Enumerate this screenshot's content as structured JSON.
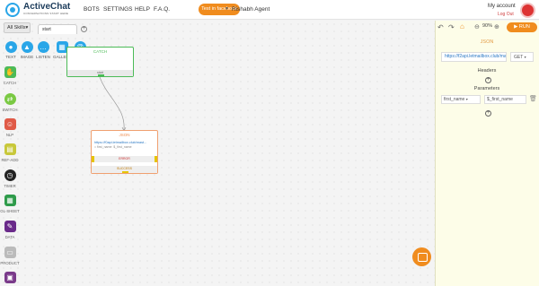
{
  "header": {
    "brand": "ActiveChat",
    "tagline": "CONVERSATIONS START HERE",
    "nav": [
      "BOTS",
      "SETTINGS",
      "HELP",
      "F.A.Q."
    ],
    "test_button": "Test in facebook",
    "agent": "Rishabh Agent",
    "account": "My account",
    "logout": "Log Out"
  },
  "canvas": {
    "skills_select": "All Skills",
    "tab": "start"
  },
  "palette": [
    {
      "label": "TEXT",
      "icon": "text-icon",
      "color": "#2aa6e8"
    },
    {
      "label": "IMAGE",
      "icon": "image-icon",
      "color": "#2aa6e8"
    },
    {
      "label": "LISTEN",
      "icon": "listen-icon",
      "color": "#2aa6e8"
    },
    {
      "label": "GALLERY",
      "icon": "gallery-icon",
      "color": "#2aa6e8"
    },
    {
      "label": "EMAIL",
      "icon": "email-icon",
      "color": "#2aa6e8"
    }
  ],
  "sidebar": [
    {
      "label": "CATCH",
      "icon": "catch-icon",
      "color": "#4cbb57"
    },
    {
      "label": "SWITCH",
      "icon": "switch-icon",
      "color": "#7ac943"
    },
    {
      "label": "NLP",
      "icon": "nlp-icon",
      "color": "#e05a47"
    },
    {
      "label": "REF-ADD",
      "icon": "ref-add-icon",
      "color": "#c8c83a"
    },
    {
      "label": "TIMER",
      "icon": "timer-icon",
      "color": "#222222"
    },
    {
      "label": "GL-SHEET",
      "icon": "sheet-icon",
      "color": "#2e9b4a"
    },
    {
      "label": "DATA",
      "icon": "data-icon",
      "color": "#6a2a8a"
    },
    {
      "label": "PRODUCT",
      "icon": "product-icon",
      "color": "#bbbbbb"
    },
    {
      "label": "",
      "icon": "shop-icon",
      "color": "#7a3a8a"
    }
  ],
  "nodes": {
    "catch": {
      "title": "CATCH",
      "footer": "start"
    },
    "json": {
      "title": "JSON",
      "url": "https://f0api.letmailbox.club/mast...",
      "params": "= first_name: $_first_name",
      "error": "ERROR",
      "success": "SUCCESS"
    }
  },
  "panel": {
    "zoom": "90%",
    "run": "RUN",
    "title": "JSON",
    "url": "https://f2api.letmailbox.club/ma",
    "method": "GET",
    "headers_label": "Headers",
    "params_label": "Parameters",
    "param_key": "first_name",
    "param_value": "$_first_name"
  }
}
